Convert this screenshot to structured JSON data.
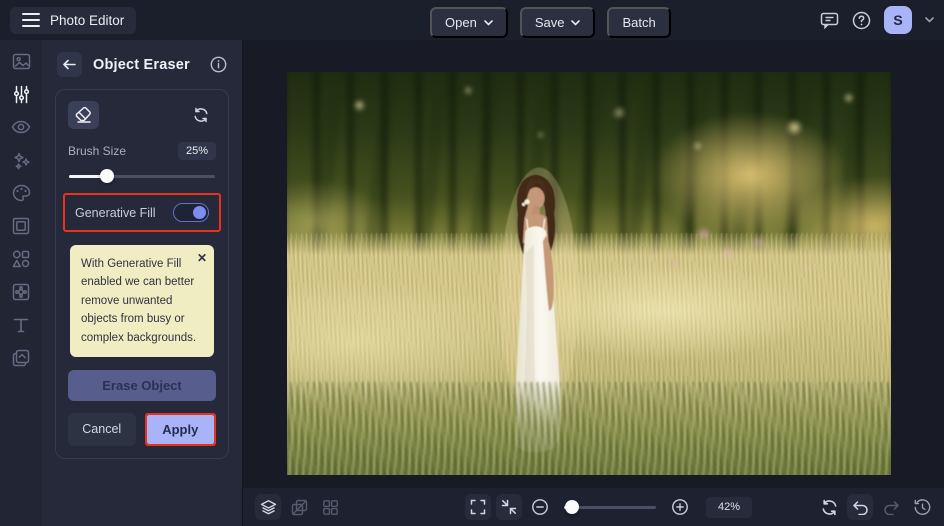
{
  "topbar": {
    "app_title": "Photo Editor",
    "open_label": "Open",
    "save_label": "Save",
    "batch_label": "Batch",
    "avatar_initial": "S"
  },
  "sidebar": {
    "items": [
      {
        "icon": "image-icon"
      },
      {
        "icon": "adjustments-icon",
        "active": true
      },
      {
        "icon": "touchup-eye-icon"
      },
      {
        "icon": "ai-sparkles-icon"
      },
      {
        "icon": "effects-palette-icon"
      },
      {
        "icon": "frame-icon"
      },
      {
        "icon": "graphics-shapes-icon"
      },
      {
        "icon": "overlay-texture-icon"
      },
      {
        "icon": "text-icon"
      },
      {
        "icon": "layers-copy-icon"
      }
    ]
  },
  "panel": {
    "title": "Object Eraser",
    "brush_size_label": "Brush Size",
    "brush_size_value": "25%",
    "generative_fill_label": "Generative Fill",
    "generative_fill_enabled": true,
    "tooltip_text": "With Generative Fill enabled we can better remove unwanted objects from busy or complex backgrounds.",
    "tooltip_close": "✕",
    "erase_button_label": "Erase Object",
    "cancel_button_label": "Cancel",
    "apply_button_label": "Apply"
  },
  "canvas": {
    "photo_description": "Woman in a white slip dress standing in a sunlit golden meadow with tall grass, blurred trees behind"
  },
  "bottombar": {
    "zoom_value": "42%"
  },
  "colors": {
    "accent_periwinkle": "#a9b3f8",
    "annotation_red": "#e8321c",
    "tooltip_yellow": "#f1edc3",
    "toggle_knob": "#7e8bf0",
    "erase_button": "#575e8e",
    "topbar_bg": "#1b1e2b",
    "panel_bg": "#252939"
  }
}
